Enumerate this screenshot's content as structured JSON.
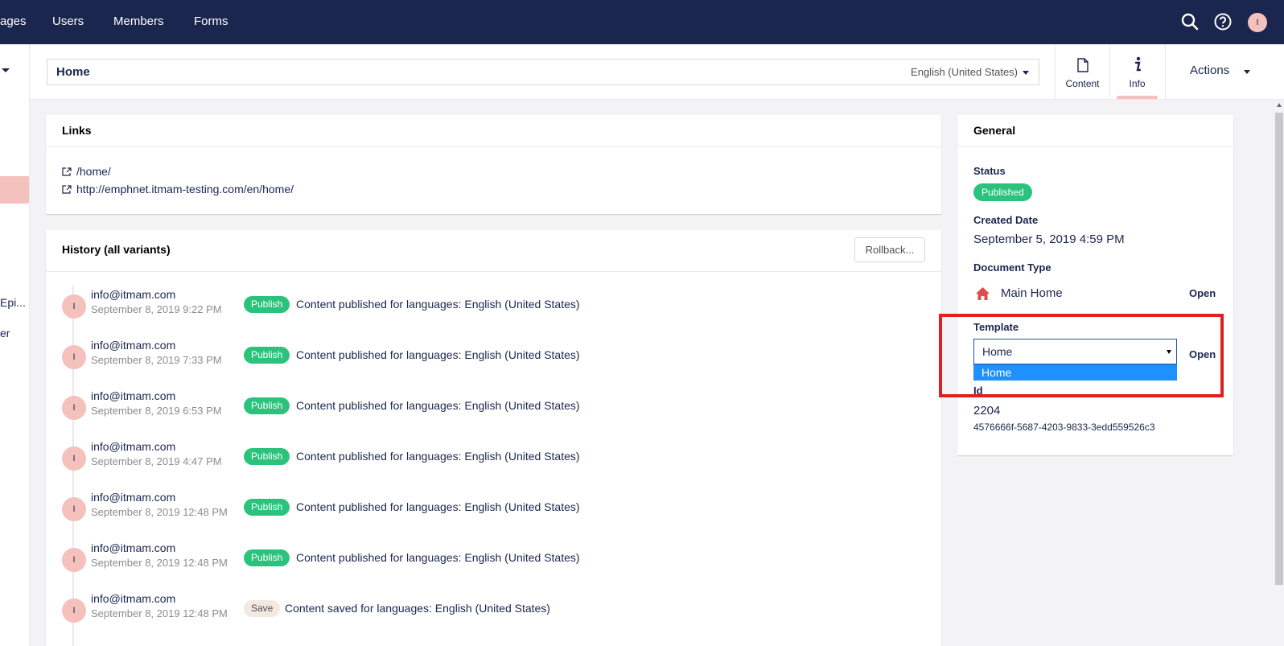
{
  "topnav": {
    "items": [
      "ages",
      "Users",
      "Members",
      "Forms"
    ],
    "avatar_initial": "I"
  },
  "sidebar": {
    "item_a": "Epi...",
    "item_b": "er"
  },
  "header": {
    "node_name": "Home",
    "language": "English (United States)",
    "apps": [
      {
        "label": "Content",
        "icon": "document-icon"
      },
      {
        "label": "Info",
        "icon": "info-icon",
        "active": true
      }
    ],
    "actions_label": "Actions"
  },
  "links": {
    "title": "Links",
    "urls": [
      "/home/",
      "http://emphnet.itmam-testing.com/en/home/"
    ]
  },
  "history": {
    "title": "History (all variants)",
    "rollback_label": "Rollback...",
    "items": [
      {
        "initial": "I",
        "email": "info@itmam.com",
        "date": "September 8, 2019 9:22 PM",
        "badge": "Publish",
        "message": "Content published for languages: English (United States)"
      },
      {
        "initial": "I",
        "email": "info@itmam.com",
        "date": "September 8, 2019 7:33 PM",
        "badge": "Publish",
        "message": "Content published for languages: English (United States)"
      },
      {
        "initial": "I",
        "email": "info@itmam.com",
        "date": "September 8, 2019 6:53 PM",
        "badge": "Publish",
        "message": "Content published for languages: English (United States)"
      },
      {
        "initial": "I",
        "email": "info@itmam.com",
        "date": "September 8, 2019 4:47 PM",
        "badge": "Publish",
        "message": "Content published for languages: English (United States)"
      },
      {
        "initial": "I",
        "email": "info@itmam.com",
        "date": "September 8, 2019 12:48 PM",
        "badge": "Publish",
        "message": "Content published for languages: English (United States)"
      },
      {
        "initial": "I",
        "email": "info@itmam.com",
        "date": "September 8, 2019 12:48 PM",
        "badge": "Publish",
        "message": "Content published for languages: English (United States)"
      },
      {
        "initial": "I",
        "email": "info@itmam.com",
        "date": "September 8, 2019 12:48 PM",
        "badge": "Save",
        "message": "Content saved for languages: English (United States)"
      }
    ]
  },
  "general": {
    "title": "General",
    "status_label": "Status",
    "status_value": "Published",
    "created_label": "Created Date",
    "created_value": "September 5, 2019 4:59 PM",
    "doctype_label": "Document Type",
    "doctype_value": "Main Home",
    "doctype_icon": "home-icon",
    "open_label": "Open",
    "template_label": "Template",
    "template_value": "Home",
    "template_options": [
      "Home"
    ],
    "id_label": "Id",
    "id_value": "2204",
    "guid": "4576666f-5687-4203-9833-3edd559526c3"
  },
  "colors": {
    "nav_bg": "#1b264f",
    "publish_green": "#2bc37c",
    "avatar_pink": "#f5c1bc",
    "highlight_red": "#e02020",
    "dropdown_blue": "#1e90ff"
  }
}
